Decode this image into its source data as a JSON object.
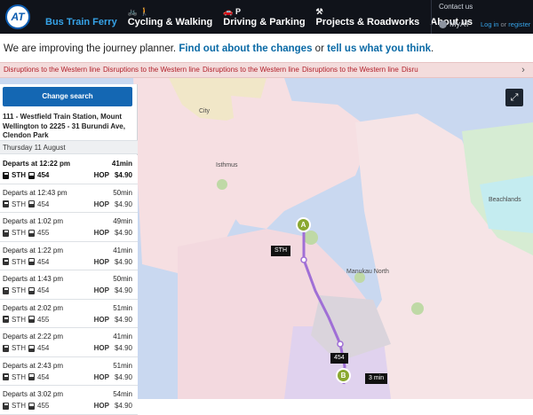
{
  "header": {
    "logo_text": "AT",
    "nav": [
      {
        "icons": "",
        "label": "Bus Train Ferry",
        "active": true
      },
      {
        "icons": "🚲 🚶",
        "label": "Cycling & Walking",
        "active": false
      },
      {
        "icons": "🚗 P",
        "label": "Driving & Parking",
        "active": false
      },
      {
        "icons": "⚒",
        "label": "Projects & Roadworks",
        "active": false
      },
      {
        "icons": "",
        "label": "About us",
        "active": false
      }
    ],
    "contact": "Contact us",
    "myat": "MyAT",
    "login": "Log in",
    "or": "or",
    "register": "register"
  },
  "notice": {
    "prefix": "We are improving the journey planner.",
    "link1": "Find out about the changes",
    "or": "or",
    "link2": "tell us what you think",
    "suffix": "."
  },
  "ticker": {
    "items": [
      "Disruptions to the Western line",
      "Disruptions to the Western line",
      "Disruptions to the Western line",
      "Disruptions to the Western line",
      "Disrupt",
      "Disru"
    ],
    "close": "›"
  },
  "map": {
    "labels": {
      "city": "City",
      "isthmus": "Isthmus",
      "manukau_north": "Manukau North",
      "beachlands": "Beachlands"
    },
    "markers": {
      "a": "A",
      "b": "B",
      "sth": "STH",
      "bus_454": "454",
      "walk": "3 min"
    },
    "expand_icon": "⤢"
  },
  "panel": {
    "change_search": "Change search",
    "route": "111 - Westfield Train Station, Mount Wellington to 2225 - 31 Burundi Ave, Clendon Park",
    "date": "Thursday 11 August",
    "journeys": [
      {
        "departs": "Departs at 12:22 pm",
        "duration": "41min",
        "train": "STH",
        "bus": "454",
        "fare_type": "HOP",
        "price": "$4.90",
        "selected": true
      },
      {
        "departs": "Departs at 12:43 pm",
        "duration": "50min",
        "train": "STH",
        "bus": "454",
        "fare_type": "HOP",
        "price": "$4.90",
        "selected": false
      },
      {
        "departs": "Departs at 1:02 pm",
        "duration": "49min",
        "train": "STH",
        "bus": "455",
        "fare_type": "HOP",
        "price": "$4.90",
        "selected": false
      },
      {
        "departs": "Departs at 1:22 pm",
        "duration": "41min",
        "train": "STH",
        "bus": "454",
        "fare_type": "HOP",
        "price": "$4.90",
        "selected": false
      },
      {
        "departs": "Departs at 1:43 pm",
        "duration": "50min",
        "train": "STH",
        "bus": "454",
        "fare_type": "HOP",
        "price": "$4.90",
        "selected": false
      },
      {
        "departs": "Departs at 2:02 pm",
        "duration": "51min",
        "train": "STH",
        "bus": "455",
        "fare_type": "HOP",
        "price": "$4.90",
        "selected": false
      },
      {
        "departs": "Departs at 2:22 pm",
        "duration": "41min",
        "train": "STH",
        "bus": "454",
        "fare_type": "HOP",
        "price": "$4.90",
        "selected": false
      },
      {
        "departs": "Departs at 2:43 pm",
        "duration": "51min",
        "train": "STH",
        "bus": "454",
        "fare_type": "HOP",
        "price": "$4.90",
        "selected": false
      },
      {
        "departs": "Departs at 3:02 pm",
        "duration": "54min",
        "train": "STH",
        "bus": "455",
        "fare_type": "HOP",
        "price": "$4.90",
        "selected": false
      }
    ]
  },
  "colors": {
    "header_bg": "#10131a",
    "active_nav": "#36a3e8",
    "button_blue": "#1467b3",
    "ticker_bg": "#f3dcdc",
    "ticker_text": "#b1202a",
    "route_line": "#a06fd6",
    "marker_green": "#8aa830"
  }
}
